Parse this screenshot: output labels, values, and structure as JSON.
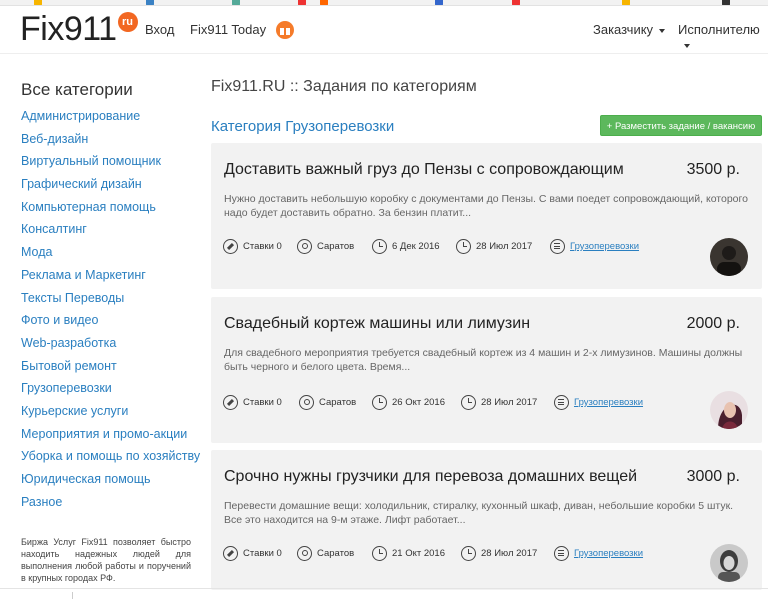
{
  "header": {
    "logo_text": "Fix911",
    "logo_badge": "ru",
    "nav_login": "Вход",
    "nav_today": "Fix911 Today",
    "nav_customer": "Заказчику",
    "nav_contractor": "Исполнителю"
  },
  "sidebar": {
    "title": "Все категории",
    "items": [
      "Администрирование",
      "Веб-дизайн",
      "Виртуальный помощник",
      "Графический дизайн",
      "Компьютерная помощь",
      "Консалтинг",
      "Мода",
      "Реклама и Маркетинг",
      "Тексты Переводы",
      "Фото и видео",
      "Web-разработка",
      "Бытовой ремонт",
      "Грузоперевозки",
      "Курьерские услуги",
      "Мероприятия и промо-акции",
      "Уборка и помощь по хозяйству",
      "Юридическая помощь",
      "Разное"
    ],
    "note": "Биржа Услуг Fix911 позволяет быстро находить надежных людей для выполнения любой работы и поручений в крупных городах РФ."
  },
  "main": {
    "page_title": "Fix911.RU :: Задания по категориям",
    "category_title": "Категория Грузоперевозки",
    "post_button": "+ Разместить задание / вакансию",
    "tasks": [
      {
        "title": "Доставить важный груз до Пензы с сопровождающим",
        "price": "3500 р.",
        "description": "Нужно доставить небольшую коробку с документами до Пензы. С вами поедет сопровождающий, которого надо будет доставить обратно. За бензин платит...",
        "bids": "Ставки 0",
        "city": "Саратов",
        "created": "6 Дек 2016",
        "deadline": "28 Июл 2017",
        "category": "Грузоперевозки"
      },
      {
        "title": "Свадебный кортеж машины или лимузин",
        "price": "2000 р.",
        "description": "Для свадебного мероприятия требуется свадебный кортеж из 4 машин и 2-х лимузинов. Машины должны быть черного и белого цвета. Время...",
        "bids": "Ставки 0",
        "city": "Саратов",
        "created": "26 Окт 2016",
        "deadline": "28 Июл 2017",
        "category": "Грузоперевозки"
      },
      {
        "title": "Срочно нужны грузчики для перевоза домашних вещей",
        "price": "3000 р.",
        "description": "Перевести домашние вещи: холодильник, стиралку, кухонный шкаф, диван, небольшие коробки 5 штук. Все это находится на 9-м этаже. Лифт работает...",
        "bids": "Ставки 0",
        "city": "Саратов",
        "created": "21 Окт 2016",
        "deadline": "28 Июл 2017",
        "category": "Грузоперевозки"
      }
    ]
  },
  "colors": {
    "link": "#2a7fc0",
    "accent_orange": "#f26722",
    "button_green": "#5cb85c",
    "card_bg": "#f2f2f2"
  }
}
